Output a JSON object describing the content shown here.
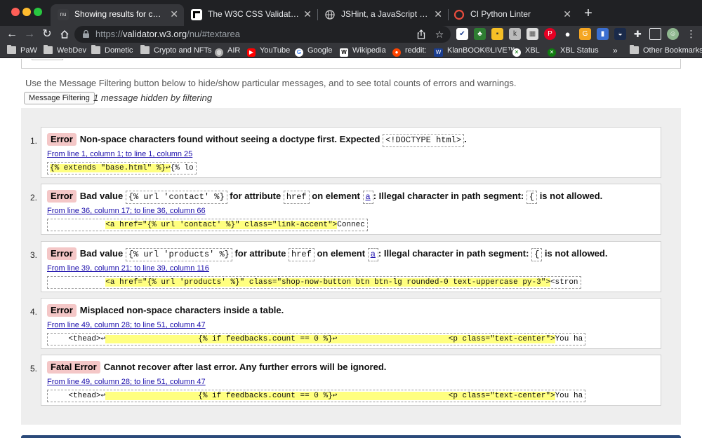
{
  "tabs": [
    {
      "title": "Showing results for contents of",
      "favicon": "nu"
    },
    {
      "title": "The W3C CSS Validation Servic"
    },
    {
      "title": "JSHint, a JavaScript Code Qua"
    },
    {
      "title": "CI Python Linter"
    }
  ],
  "address": {
    "prefix": "https://",
    "host": "validator.w3.org",
    "path": "/nu/#textarea"
  },
  "bookmarks": [
    "PaW",
    "WebDev",
    "Dometic",
    "Crypto and NFTs",
    "AIR",
    "YouTube",
    "Google",
    "Wikipedia",
    "reddit:",
    "KlanBOOK®LIVE™",
    "XBL",
    "XBL Status",
    "»",
    "Other Bookmarks"
  ],
  "colors": {
    "chrome_bg": "#202124",
    "toolbar_bg": "#35363a",
    "error_badge": "#f4c7c7",
    "highlight": "#ffff80",
    "link": "#1a0dab",
    "results_bg": "#eeeeee"
  },
  "page": {
    "filter_text": "Use the Message Filtering button below to hide/show particular messages, and to see total counts of errors and warnings.",
    "filter_button": "Message Filtering",
    "hidden_note": "1 message hidden by filtering"
  },
  "messages": [
    {
      "num": "1.",
      "type": "Error",
      "t1": "Non-space characters found without seeing a doctype first. Expected ",
      "c1": "<!DOCTYPE html>",
      "t2": ".",
      "loc": "From line 1, column 1; to line 1, column 25",
      "ex_hl": "{% extends \"base.html\" %}↩",
      "ex_post": "{% lo"
    },
    {
      "num": "2.",
      "type": "Error",
      "t1": "Bad value ",
      "c1": "{% url 'contact' %}",
      "t2": " for attribute ",
      "c2": "href",
      "t3": " on element ",
      "c3": "a",
      "t4": ": Illegal character in path segment: ",
      "c4": "{",
      "t5": " is not allowed.",
      "loc": "From line 36, column 17; to line 36, column 66",
      "ex_pre": "            ",
      "ex_hl": "<a href=\"{% url 'contact' %}\" class=\"link-accent\">",
      "ex_post": "Connec"
    },
    {
      "num": "3.",
      "type": "Error",
      "t1": "Bad value ",
      "c1": "{% url 'products' %}",
      "t2": " for attribute ",
      "c2": "href",
      "t3": " on element ",
      "c3": "a",
      "t4": ": Illegal character in path segment: ",
      "c4": "{",
      "t5": " is not allowed.",
      "loc": "From line 39, column 21; to line 39, column 116",
      "ex_pre": "            ",
      "ex_hl": "<a href=\"{% url 'products' %}\" class=\"shop-now-button btn btn-lg rounded-0 text-uppercase py-3\">",
      "ex_post": "<stron"
    },
    {
      "num": "4.",
      "type": "Error",
      "t1": "Misplaced non-space characters inside a table.",
      "loc": "From line 49, column 28; to line 51, column 47",
      "ex_pre": "    <thead>↩",
      "ex_hl": "                    {% if feedbacks.count == 0 %}↩                        <p class=\"text-center\">",
      "ex_post": "You ha"
    },
    {
      "num": "5.",
      "type": "Fatal Error",
      "t1": "Cannot recover after last error. Any further errors will be ignored.",
      "loc": "From line 49, column 28; to line 51, column 47",
      "ex_pre": "    <thead>↩",
      "ex_hl": "                    {% if feedbacks.count == 0 %}↩                        <p class=\"text-center\">",
      "ex_post": "You ha"
    }
  ]
}
